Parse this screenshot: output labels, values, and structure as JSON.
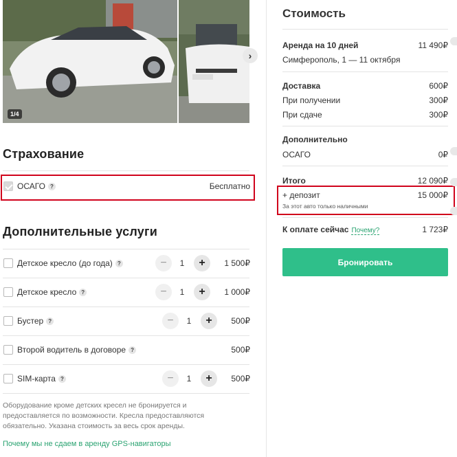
{
  "gallery": {
    "counter": "1/4",
    "next_icon": "chevron-right-icon"
  },
  "insurance": {
    "heading": "Страхование",
    "item": {
      "label": "ОСАГО",
      "help": "?",
      "price": "Бесплатно",
      "checked": true
    }
  },
  "services": {
    "heading": "Дополнительные услуги",
    "minus": "−",
    "plus": "+",
    "items": [
      {
        "label": "Детское кресло (до года)",
        "help": "?",
        "qty": "1",
        "price": "1 500₽"
      },
      {
        "label": "Детское кресло",
        "help": "?",
        "qty": "1",
        "price": "1 000₽"
      },
      {
        "label": "Бустер",
        "help": "?",
        "qty": "1",
        "price": "500₽"
      },
      {
        "label": "Второй водитель в договоре",
        "help": "?",
        "price": "500₽"
      },
      {
        "label": "SIM-карта",
        "help": "?",
        "qty": "1",
        "price": "500₽"
      }
    ],
    "note": "Оборудование кроме детских кресел не бронируется и предоставляется по возможности. Кресла предоставляются обязательно. Указана стоимость за весь срок аренды.",
    "gps_link": "Почему мы не сдаем в аренду GPS-навигаторы"
  },
  "cost": {
    "title": "Стоимость",
    "rent_label": "Аренда на 10 дней",
    "rent_value": "11 490₽",
    "rent_details": "Симферополь, 1 — 11 октября",
    "delivery_label": "Доставка",
    "delivery_value": "600₽",
    "pickup_label": "При получении",
    "pickup_value": "300₽",
    "return_label": "При сдаче",
    "return_value": "300₽",
    "extra_label": "Дополнительно",
    "osago_label": "ОСАГО",
    "osago_value": "0₽",
    "total_label": "Итого",
    "total_value": "12 090₽",
    "deposit_label": "+ депозит",
    "deposit_value": "15 000₽",
    "deposit_note": "За этот авто только наличными",
    "pay_now_label": "К оплате сейчас",
    "why_link": "Почему?",
    "pay_now_value": "1 723₽",
    "book_button": "Бронировать"
  }
}
